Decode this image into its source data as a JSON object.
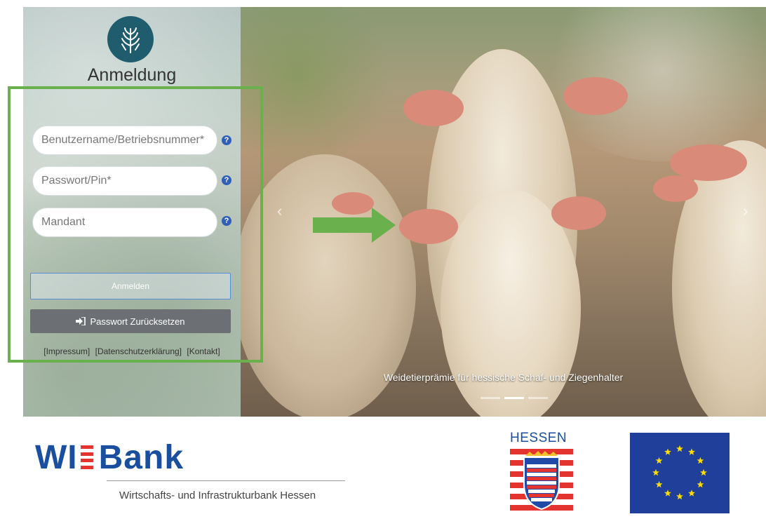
{
  "login": {
    "title": "Anmeldung",
    "fields": {
      "username_placeholder": "Benutzername/Betriebsnummer*",
      "password_placeholder": "Passwort/Pin*",
      "mandant_placeholder": "Mandant"
    },
    "help_icon": "question-circle-icon",
    "login_button": "Anmelden",
    "reset_button": "Passwort Zurücksetzen",
    "reset_icon": "sign-in-icon",
    "links": [
      "[Impressum]",
      "[Datenschutzerklärung]",
      "[Kontakt]"
    ]
  },
  "carousel": {
    "caption": "Weidetierprämie für hessische Schaf- und Ziegenhalter",
    "indicator_count": 3,
    "active_indicator": 1
  },
  "footer": {
    "wibank_left": "WI",
    "wibank_right": "Bank",
    "wibank_subtitle": "Wirtschafts- und Infrastrukturbank Hessen",
    "hessen_label": "HESSEN"
  },
  "colors": {
    "accent_green": "#6ab04c",
    "logo_teal": "#1f5c6e",
    "wibank_blue": "#1a4fa0",
    "wibank_red": "#e3342f",
    "eu_blue": "#1f3f9a",
    "eu_star": "#ffdd00"
  }
}
